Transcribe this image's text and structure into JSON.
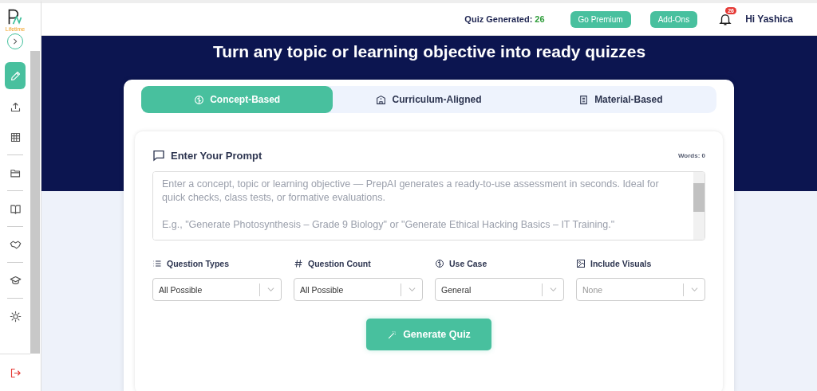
{
  "sidebar": {
    "logo_caption": "Lifetime",
    "items": [
      {
        "selected": true
      },
      {
        "selected": false
      },
      {
        "selected": false
      },
      {
        "selected": false
      },
      {
        "selected": false
      },
      {
        "selected": false
      },
      {
        "selected": false
      },
      {
        "selected": false
      }
    ]
  },
  "header": {
    "quiz_generated_label": "Quiz Generated:",
    "quiz_generated_count": "26",
    "buttons": [
      "Go Premium",
      "Add-Ons"
    ],
    "notification_count": "26",
    "greeting": "Hi Yashica"
  },
  "hero_title": "Turn any topic or learning objective into ready quizzes",
  "tabs": [
    {
      "label": "Concept-Based",
      "selected": true
    },
    {
      "label": "Curriculum-Aligned",
      "selected": false
    },
    {
      "label": "Material-Based",
      "selected": false
    }
  ],
  "prompt": {
    "title": "Enter Your Prompt",
    "word_count": "Words: 0",
    "placeholder": "Enter a concept, topic or learning objective — PrepAI generates a ready-to-use assessment in seconds. Ideal for quick checks, class tests, or formative evaluations.\n\nE.g., \"Generate Photosynthesis – Grade 9 Biology\" or \"Generate Ethical Hacking Basics – IT Training.\""
  },
  "options": [
    {
      "label": "Question Types",
      "value": "All Possible"
    },
    {
      "label": "Question Count",
      "value": "All Possible"
    },
    {
      "label": "Use Case",
      "value": "General"
    },
    {
      "label": "Include Visuals",
      "placeholder": "None"
    }
  ],
  "generate_button": "Generate Quiz"
}
